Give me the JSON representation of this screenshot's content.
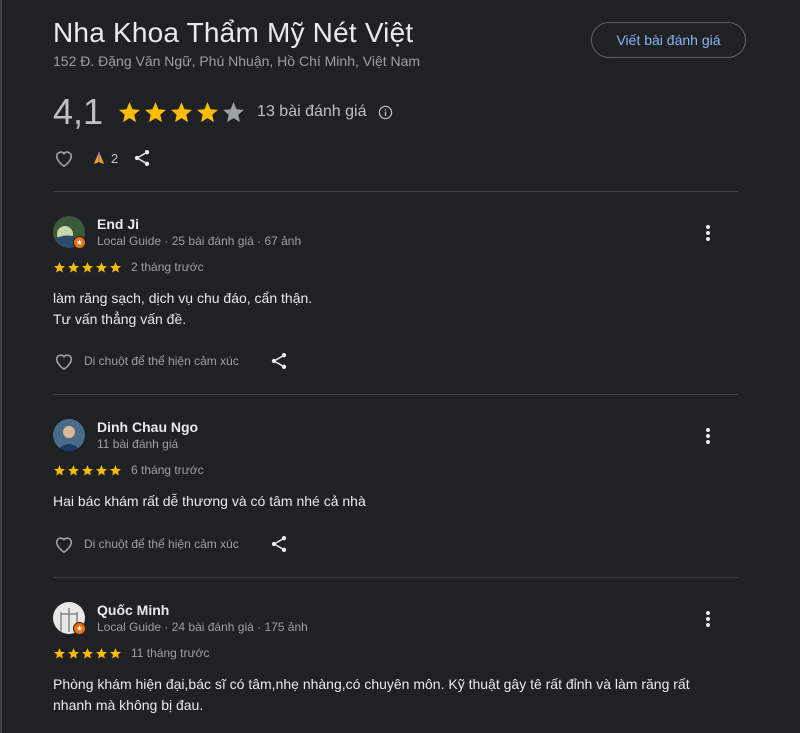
{
  "place": {
    "title": "Nha Khoa Thẩm Mỹ Nét Việt",
    "address": "152 Đ. Đặng Văn Ngữ, Phú Nhuận, Hồ Chí Minh, Việt Nam",
    "write_review_label": "Viết bài đánh giá",
    "rating": "4,1",
    "stars_filled": 4,
    "stars_total": 5,
    "review_count": "13 bài đánh giá",
    "pray_count": "2"
  },
  "reviews": [
    {
      "name": "End Ji",
      "meta": "Local Guide · 25 bài đánh giá · 67 ảnh",
      "stars": 5,
      "time": "2 tháng trước",
      "text_lines": [
        "làm răng sạch, dịch vụ chu đáo, cẩn thận.",
        "Tư vấn thẳng vấn đề."
      ],
      "react_label": "Di chuột để thể hiện cảm xúc"
    },
    {
      "name": "Dinh Chau Ngo",
      "meta": "11 bài đánh giá",
      "stars": 5,
      "time": "6 tháng trước",
      "text_lines": [
        "Hai bác khám rất dễ thương và có tâm nhé cả nhà"
      ],
      "react_label": "Di chuột để thể hiện cảm xúc"
    },
    {
      "name": "Quốc Minh",
      "meta": "Local Guide · 24 bài đánh giá · 175 ảnh",
      "stars": 5,
      "time": "11 tháng trước",
      "text_lines": [
        "Phòng khám hiện đại,bác sĩ có tâm,nhẹ nhàng,có chuyên môn. Kỹ thuật gây tê rất đỉnh và làm răng rất",
        "nhanh mà không bị đau."
      ],
      "react_label": ""
    }
  ],
  "colors": {
    "background": "#202124",
    "star": "#fbbc04",
    "star_empty": "#9aa0a6",
    "link": "#8ab4f8",
    "local_guide_badge": "#e8710a"
  },
  "icons": [
    "star-icon",
    "info-icon",
    "heart-icon",
    "pray-icon",
    "share-icon",
    "more-vert-icon"
  ]
}
